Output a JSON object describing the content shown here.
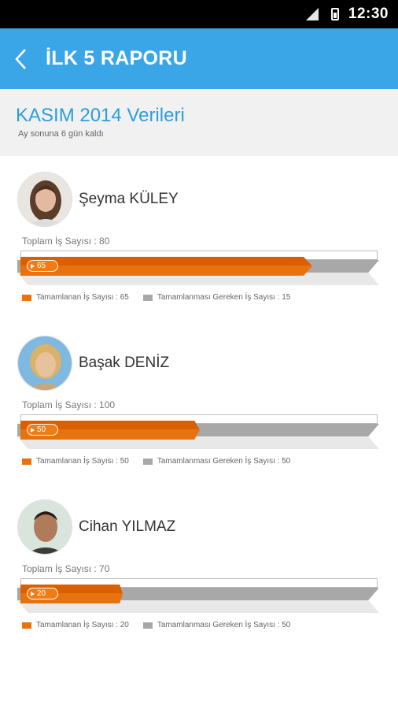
{
  "status_bar": {
    "time": "12:30"
  },
  "app_bar": {
    "title": "İLK 5 RAPORU"
  },
  "period": {
    "title": "KASIM 2014 Verileri",
    "subtitle": "Ay sonuna 6 gün kaldı"
  },
  "labels": {
    "total_label": "Toplam İş Sayısı",
    "completed_label": "Tamamlanan İş Sayısı",
    "remaining_label": "Tamamlanması Gereken İş Sayısı"
  },
  "people": [
    {
      "name": "Şeyma KÜLEY",
      "total": "80",
      "completed": "65",
      "remaining": "15",
      "completed_fraction": 0.8125,
      "legend_completed": "Tamamlanan İş Sayısı : 65",
      "legend_remaining": "Tamamlanması Gereken İş Sayısı : 15",
      "total_text": "Toplam İş Sayısı  :  80"
    },
    {
      "name": "Başak DENİZ",
      "total": "100",
      "completed": "50",
      "remaining": "50",
      "completed_fraction": 0.5,
      "legend_completed": "Tamamlanan İş Sayısı : 50",
      "legend_remaining": "Tamamlanması Gereken İş Sayısı : 50",
      "total_text": "Toplam İş Sayısı  :  100"
    },
    {
      "name": "Cihan YILMAZ",
      "total": "70",
      "completed": "20",
      "remaining": "50",
      "completed_fraction": 0.2857,
      "legend_completed": "Tamamlanan İş Sayısı : 20",
      "legend_remaining": "Tamamlanması Gereken İş Sayısı : 50",
      "total_text": "Toplam İş Sayısı  :  70"
    }
  ],
  "colors": {
    "accent": "#3aa6e8",
    "completed": "#e8730e",
    "remaining": "#a8a8a8"
  }
}
